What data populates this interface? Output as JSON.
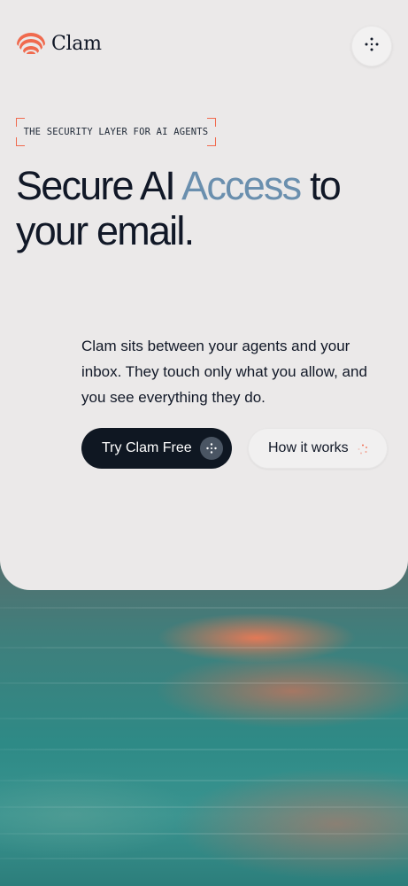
{
  "brand": {
    "name": "Clam",
    "accent_color": "#f06a4e",
    "logo_icon": "clam-shell-icon"
  },
  "header": {
    "menu_icon": "dots-cross-icon"
  },
  "hero": {
    "tagline": "THE SECURITY LAYER FOR AI AGENTS",
    "headline_part1": "Secure AI ",
    "headline_accent": "Access",
    "headline_part2": " to your email.",
    "headline_accent_color": "#6a8fae",
    "description": "Clam sits between your agents and your inbox.  They touch only what you allow, and you see everything they do."
  },
  "actions": {
    "primary_label": "Try Clam Free",
    "primary_icon": "dots-cross-icon",
    "secondary_label": "How it works",
    "secondary_icon": "loading-dots-icon"
  },
  "colors": {
    "card_background": "#ebe9e9",
    "text_dark": "#111827",
    "primary_button": "#0f1722"
  }
}
